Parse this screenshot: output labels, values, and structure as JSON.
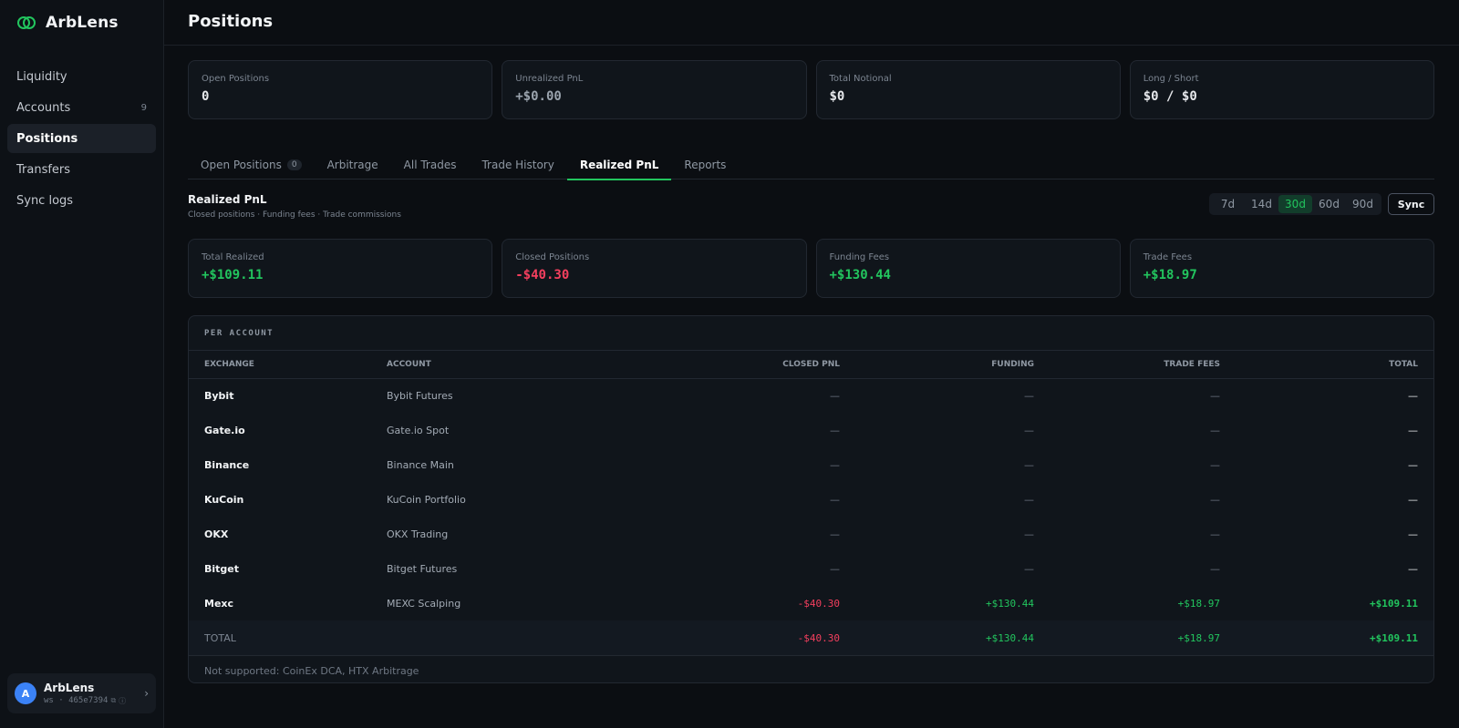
{
  "brand": {
    "name": "ArbLens"
  },
  "sidebar": {
    "items": [
      {
        "label": "Liquidity",
        "badge": ""
      },
      {
        "label": "Accounts",
        "badge": "9"
      },
      {
        "label": "Positions",
        "badge": ""
      },
      {
        "label": "Transfers",
        "badge": ""
      },
      {
        "label": "Sync logs",
        "badge": ""
      }
    ],
    "user": {
      "avatar": "A",
      "name": "ArbLens",
      "sub": "ws · 465e7394"
    }
  },
  "header": {
    "title": "Positions"
  },
  "summary": [
    {
      "label": "Open Positions",
      "value": "0"
    },
    {
      "label": "Unrealized PnL",
      "value": "+$0.00"
    },
    {
      "label": "Total Notional",
      "value": "$0"
    },
    {
      "label": "Long / Short",
      "value": "$0 / $0"
    }
  ],
  "tabs": [
    {
      "label": "Open Positions",
      "count": "0"
    },
    {
      "label": "Arbitrage"
    },
    {
      "label": "All Trades"
    },
    {
      "label": "Trade History"
    },
    {
      "label": "Realized PnL"
    },
    {
      "label": "Reports"
    }
  ],
  "realized": {
    "title": "Realized PnL",
    "subtitle": "Closed positions · Funding fees · Trade commissions",
    "ranges": [
      "7d",
      "14d",
      "30d",
      "60d",
      "90d"
    ],
    "active_range": "30d",
    "sync_label": "Sync",
    "stats": [
      {
        "label": "Total Realized",
        "value": "+$109.11"
      },
      {
        "label": "Closed Positions",
        "value": "-$40.30"
      },
      {
        "label": "Funding Fees",
        "value": "+$130.44"
      },
      {
        "label": "Trade Fees",
        "value": "+$18.97"
      }
    ]
  },
  "per_account": {
    "title": "PER ACCOUNT",
    "columns": [
      "EXCHANGE",
      "ACCOUNT",
      "CLOSED PNL",
      "FUNDING",
      "TRADE FEES",
      "TOTAL"
    ],
    "rows": [
      {
        "exchange": "Bybit",
        "account": "Bybit Futures",
        "closed": "—",
        "funding": "—",
        "fees": "—",
        "total": "—"
      },
      {
        "exchange": "Gate.io",
        "account": "Gate.io Spot",
        "closed": "—",
        "funding": "—",
        "fees": "—",
        "total": "—"
      },
      {
        "exchange": "Binance",
        "account": "Binance Main",
        "closed": "—",
        "funding": "—",
        "fees": "—",
        "total": "—"
      },
      {
        "exchange": "KuCoin",
        "account": "KuCoin Portfolio",
        "closed": "—",
        "funding": "—",
        "fees": "—",
        "total": "—"
      },
      {
        "exchange": "OKX",
        "account": "OKX Trading",
        "closed": "—",
        "funding": "—",
        "fees": "—",
        "total": "—"
      },
      {
        "exchange": "Bitget",
        "account": "Bitget Futures",
        "closed": "—",
        "funding": "—",
        "fees": "—",
        "total": "—"
      },
      {
        "exchange": "Mexc",
        "account": "MEXC Scalping",
        "closed": "-$40.30",
        "funding": "+$130.44",
        "fees": "+$18.97",
        "total": "+$109.11"
      }
    ],
    "total_row": {
      "label": "TOTAL",
      "closed": "-$40.30",
      "funding": "+$130.44",
      "fees": "+$18.97",
      "total": "+$109.11"
    },
    "footer": "Not supported: CoinEx DCA, HTX Arbitrage"
  },
  "colors": {
    "accent": "#22c55e",
    "negative": "#f43f5e",
    "background": "#0b0e12"
  }
}
